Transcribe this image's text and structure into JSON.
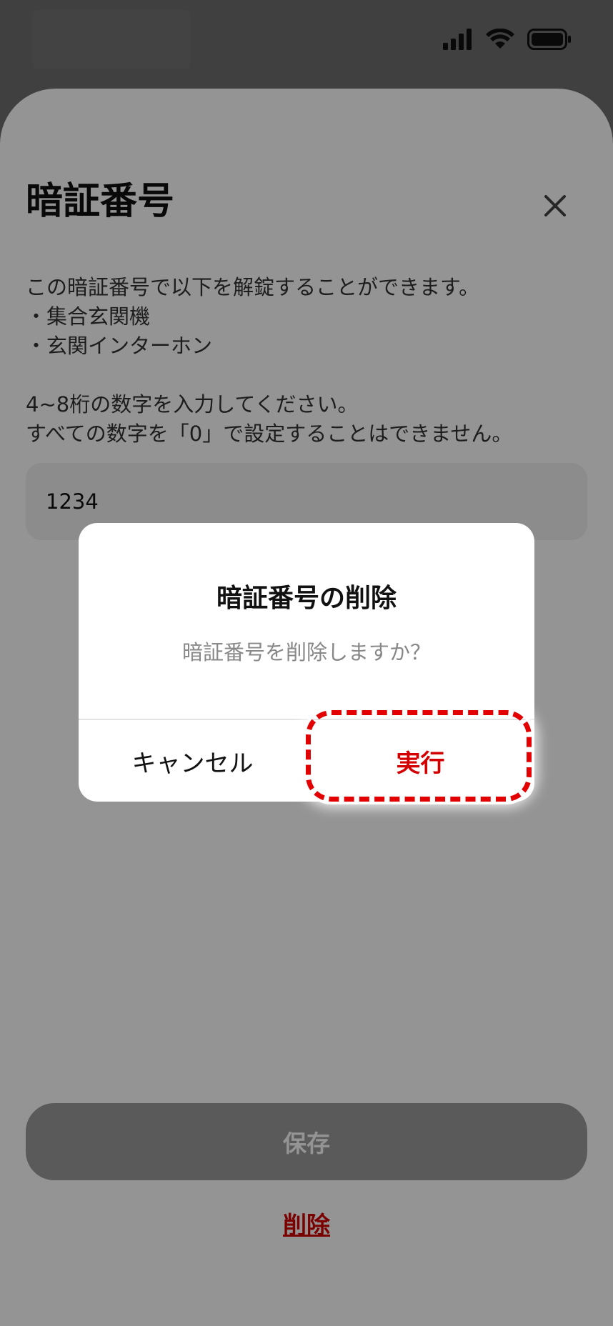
{
  "status_bar": {
    "signal_icon": "signal-bars-icon",
    "wifi_icon": "wifi-icon",
    "battery_icon": "battery-icon"
  },
  "sheet": {
    "title": "暗証番号",
    "close_icon": "close-icon",
    "description_lines": [
      "この暗証番号で以下を解錠することができます。",
      "・集合玄関機",
      "・玄関インターホン",
      "",
      "4~8桁の数字を入力してください。",
      "すべての数字を「0」で設定することはできません。"
    ],
    "pin_value": "1234",
    "save_label": "保存",
    "delete_label": "削除"
  },
  "dialog": {
    "title": "暗証番号の削除",
    "message": "暗証番号を削除しますか？",
    "cancel_label": "キャンセル",
    "execute_label": "実行"
  },
  "colors": {
    "accent_red": "#d40000",
    "highlight_red": "#e30000"
  }
}
